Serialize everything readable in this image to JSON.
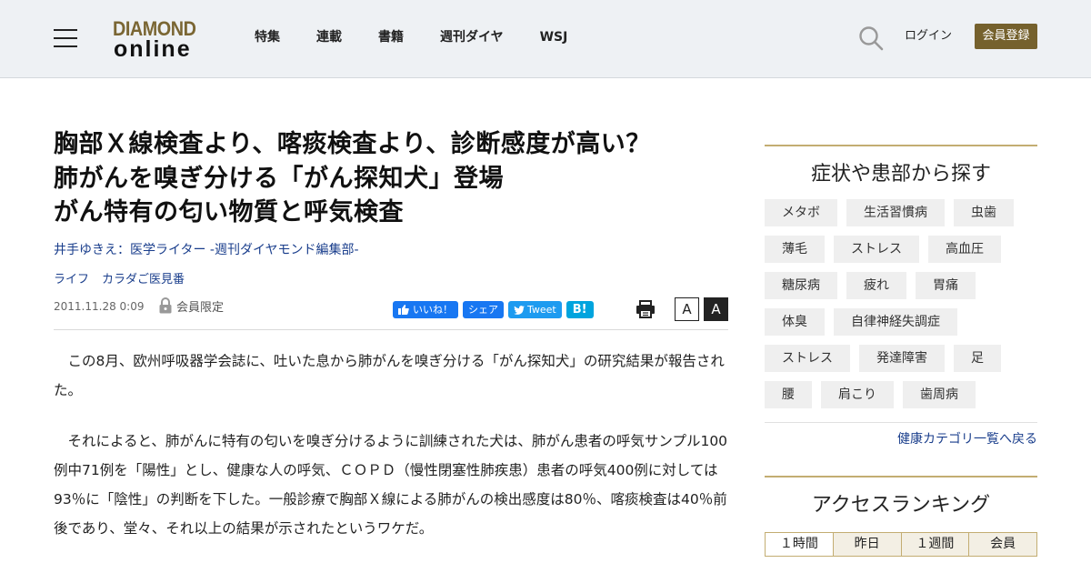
{
  "header": {
    "logo_top": "DIAMOND",
    "logo_bottom": "online",
    "nav": [
      "特集",
      "連載",
      "書籍",
      "週刊ダイヤ",
      "WSJ"
    ],
    "login_label": "ログイン",
    "register_label": "会員登録",
    "brand_color": "#75612d"
  },
  "article": {
    "title_lines": [
      "胸部Ｘ線検査より、喀痰検査より、診断感度が高い？",
      "肺がんを嗅ぎ分ける「がん探知犬」登場",
      "がん特有の匂い物質と呼気検査"
    ],
    "author": "井手ゆきえ：医学ライター -週刊ダイヤモンド編集部-",
    "categories": [
      "ライフ",
      "カラダご医見番"
    ],
    "date": "2011.11.28 0:09",
    "members_only": "会員限定",
    "share": {
      "like": "いいね！",
      "share": "シェア",
      "tweet": "Tweet",
      "hatena": "B!"
    },
    "font_small": "A",
    "font_large": "A",
    "paragraphs": [
      "この8月、欧州呼吸器学会誌に、吐いた息から肺がんを嗅ぎ分ける「がん探知犬」の研究結果が報告された。",
      "それによると、肺がんに特有の匂いを嗅ぎ分けるように訓練された犬は、肺がん患者の呼気サンプル100例中71例を「陽性」とし、健康な人の呼気、ＣＯＰＤ（慢性閉塞性肺疾患）患者の呼気400例に対しては93％に「陰性」の判断を下した。一般診療で胸部Ｘ線による肺がんの検出感度は80％、喀痰検査は40％前後であり、堂々、それ以上の結果が示されたというワケだ。"
    ]
  },
  "sidebar": {
    "symptoms_title": "症状や患部から探す",
    "tags": [
      "メタボ",
      "生活習慣病",
      "虫歯",
      "薄毛",
      "ストレス",
      "高血圧",
      "糖尿病",
      "疲れ",
      "胃痛",
      "体臭",
      "自律神経失調症",
      "ストレス",
      "発達障害",
      "足",
      "腰",
      "肩こり",
      "歯周病"
    ],
    "back_link": "健康カテゴリ一覧へ戻る",
    "ranking_title": "アクセスランキング",
    "ranking_tabs": [
      "１時間",
      "昨日",
      "１週間",
      "会員"
    ]
  }
}
